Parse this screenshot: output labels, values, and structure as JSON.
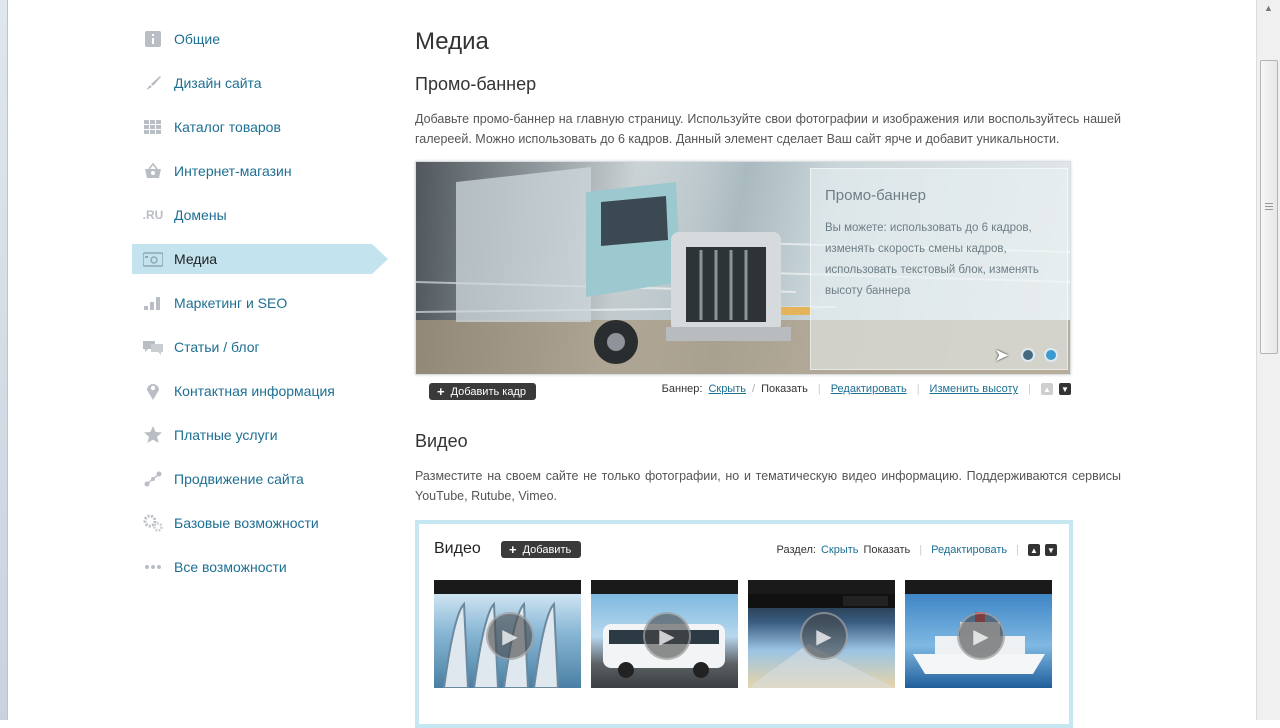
{
  "sidebar": {
    "items": [
      {
        "label": "Общие",
        "icon": "info-icon"
      },
      {
        "label": "Дизайн сайта",
        "icon": "brush-icon"
      },
      {
        "label": "Каталог товаров",
        "icon": "grid-icon"
      },
      {
        "label": "Интернет-магазин",
        "icon": "basket-icon"
      },
      {
        "label": "Домены",
        "icon": "ru-domain-icon",
        "icon_text": ".RU"
      },
      {
        "label": "Медиа",
        "icon": "media-icon",
        "active": true
      },
      {
        "label": "Маркетинг и SEO",
        "icon": "bars-icon"
      },
      {
        "label": "Статьи / блог",
        "icon": "chat-icon"
      },
      {
        "label": "Контактная информация",
        "icon": "pin-icon"
      },
      {
        "label": "Платные услуги",
        "icon": "star-icon"
      },
      {
        "label": "Продвижение сайта",
        "icon": "share-icon"
      },
      {
        "label": "Базовые возможности",
        "icon": "gears-icon"
      },
      {
        "label": "Все возможности",
        "icon": "dots-icon"
      }
    ]
  },
  "main": {
    "title": "Медиа",
    "promo": {
      "heading": "Промо-баннер",
      "description": "Добавьте промо-баннер на главную страницу. Используйте свои фотографии и изображения или воспользуйтесь нашей галереей. Можно использовать до 6 кадров. Данный элемент сделает Ваш сайт ярче и добавит уникальности.",
      "overlay_title": "Промо-баннер",
      "overlay_text": "Вы можете: использовать до 6 кадров, изменять скорость смены кадров, использовать текстовый блок, изменять высоту баннера",
      "add_frame_label": "Добавить кадр",
      "banner_label": "Баннер:",
      "hide_label": "Скрыть",
      "slash": "/",
      "show_label": "Показать",
      "edit_label": "Редактировать",
      "height_label": "Изменить высоту"
    },
    "video": {
      "heading": "Видео",
      "description": "Разместите на своем сайте не только фотографии, но и тематическую видео информацию. Поддерживаются сервисы YouTube, Rutube, Vimeo.",
      "box_title": "Видео",
      "add_label": "Добавить",
      "section_label": "Раздел:",
      "hide_label": "Скрыть",
      "show_label": "Показать",
      "edit_label": "Редактировать"
    }
  }
}
